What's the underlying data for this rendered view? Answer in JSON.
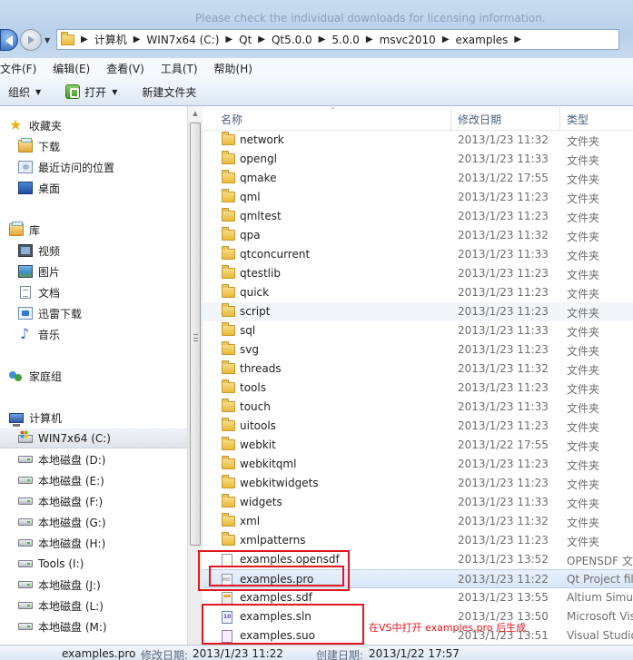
{
  "window": {
    "blurred_notice": "Please check the individual downloads for licensing information."
  },
  "address_bar": {
    "crumbs": [
      "计算机",
      "WIN7x64 (C:)",
      "Qt",
      "Qt5.0.0",
      "5.0.0",
      "msvc2010",
      "examples"
    ]
  },
  "menu": [
    "文件(F)",
    "编辑(E)",
    "查看(V)",
    "工具(T)",
    "帮助(H)"
  ],
  "toolbar": {
    "organize": "组织",
    "open": "打开",
    "new_folder": "新建文件夹"
  },
  "nav": {
    "favorites": {
      "label": "收藏夹",
      "items": [
        "下载",
        "最近访问的位置",
        "桌面"
      ]
    },
    "libraries": {
      "label": "库",
      "items": [
        "视频",
        "图片",
        "文档",
        "迅雷下载",
        "音乐"
      ]
    },
    "homegroup": "家庭组",
    "computer": {
      "label": "计算机",
      "drives": [
        "WIN7x64 (C:)",
        "本地磁盘 (D:)",
        "本地磁盘 (E:)",
        "本地磁盘 (F:)",
        "本地磁盘 (G:)",
        "本地磁盘 (H:)",
        "Tools (I:)",
        "本地磁盘 (J:)",
        "本地磁盘 (L:)",
        "本地磁盘 (M:)"
      ]
    }
  },
  "columns": {
    "name": "名称",
    "date": "修改日期",
    "type": "类型"
  },
  "files": [
    {
      "name": "network",
      "date": "2013/1/23 11:32",
      "type": "文件夹",
      "kind": "folder"
    },
    {
      "name": "opengl",
      "date": "2013/1/23 11:33",
      "type": "文件夹",
      "kind": "folder"
    },
    {
      "name": "qmake",
      "date": "2013/1/22 17:55",
      "type": "文件夹",
      "kind": "folder"
    },
    {
      "name": "qml",
      "date": "2013/1/23 11:23",
      "type": "文件夹",
      "kind": "folder"
    },
    {
      "name": "qmltest",
      "date": "2013/1/23 11:23",
      "type": "文件夹",
      "kind": "folder"
    },
    {
      "name": "qpa",
      "date": "2013/1/23 11:32",
      "type": "文件夹",
      "kind": "folder"
    },
    {
      "name": "qtconcurrent",
      "date": "2013/1/23 11:33",
      "type": "文件夹",
      "kind": "folder"
    },
    {
      "name": "qtestlib",
      "date": "2013/1/23 11:23",
      "type": "文件夹",
      "kind": "folder"
    },
    {
      "name": "quick",
      "date": "2013/1/23 11:23",
      "type": "文件夹",
      "kind": "folder"
    },
    {
      "name": "script",
      "date": "2013/1/23 11:23",
      "type": "文件夹",
      "kind": "folder",
      "selected": true
    },
    {
      "name": "sql",
      "date": "2013/1/23 11:33",
      "type": "文件夹",
      "kind": "folder"
    },
    {
      "name": "svg",
      "date": "2013/1/23 11:23",
      "type": "文件夹",
      "kind": "folder"
    },
    {
      "name": "threads",
      "date": "2013/1/23 11:32",
      "type": "文件夹",
      "kind": "folder"
    },
    {
      "name": "tools",
      "date": "2013/1/23 11:23",
      "type": "文件夹",
      "kind": "folder"
    },
    {
      "name": "touch",
      "date": "2013/1/23 11:33",
      "type": "文件夹",
      "kind": "folder"
    },
    {
      "name": "uitools",
      "date": "2013/1/23 11:23",
      "type": "文件夹",
      "kind": "folder"
    },
    {
      "name": "webkit",
      "date": "2013/1/22 17:55",
      "type": "文件夹",
      "kind": "folder"
    },
    {
      "name": "webkitqml",
      "date": "2013/1/23 11:23",
      "type": "文件夹",
      "kind": "folder"
    },
    {
      "name": "webkitwidgets",
      "date": "2013/1/23 11:23",
      "type": "文件夹",
      "kind": "folder"
    },
    {
      "name": "widgets",
      "date": "2013/1/23 11:33",
      "type": "文件夹",
      "kind": "folder"
    },
    {
      "name": "xml",
      "date": "2013/1/23 11:32",
      "type": "文件夹",
      "kind": "folder"
    },
    {
      "name": "xmlpatterns",
      "date": "2013/1/23 11:23",
      "type": "文件夹",
      "kind": "folder"
    },
    {
      "name": "examples.opensdf",
      "date": "2013/1/23 13:52",
      "type": "OPENSDF 文",
      "kind": "file"
    },
    {
      "name": "examples.pro",
      "date": "2013/1/23 11:22",
      "type": "Qt Project fil",
      "kind": "pro",
      "selected_strong": true
    },
    {
      "name": "examples.sdf",
      "date": "2013/1/23 13:55",
      "type": "Altium Simula",
      "kind": "sdf"
    },
    {
      "name": "examples.sln",
      "date": "2013/1/23 13:50",
      "type": "Microsoft Vis",
      "kind": "sln"
    },
    {
      "name": "examples.suo",
      "date": "2013/1/23 13:51",
      "type": "Visual Studio",
      "kind": "suo"
    }
  ],
  "annotation": {
    "note": "在VS中打开 examples.pro 后生成",
    "color": "#e2161d"
  },
  "details": {
    "name": "examples.pro",
    "modified_label": "修改日期:",
    "modified": "2013/1/23 11:22",
    "created_label": "创建日期:",
    "created": "2013/1/22 17:57"
  }
}
